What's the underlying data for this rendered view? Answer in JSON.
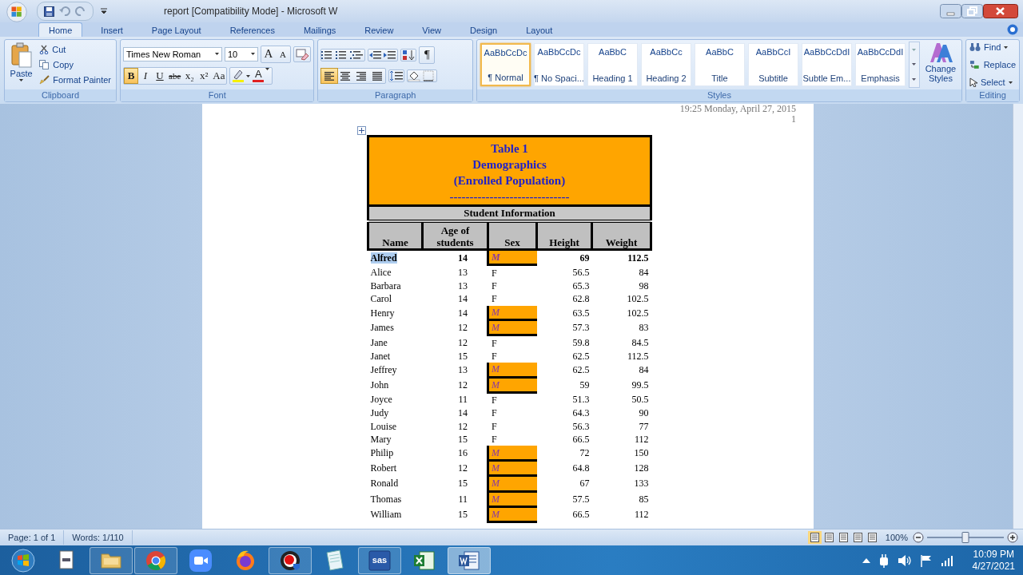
{
  "title_bar": {
    "title": "report [Compatibility Mode] - Microsoft W"
  },
  "tabs": [
    {
      "label": "Home",
      "selected": true
    },
    {
      "label": "Insert",
      "selected": false
    },
    {
      "label": "Page Layout",
      "selected": false
    },
    {
      "label": "References",
      "selected": false
    },
    {
      "label": "Mailings",
      "selected": false
    },
    {
      "label": "Review",
      "selected": false
    },
    {
      "label": "View",
      "selected": false
    },
    {
      "label": "Design",
      "selected": false
    },
    {
      "label": "Layout",
      "selected": false
    }
  ],
  "ribbon": {
    "clipboard": {
      "label": "Clipboard",
      "paste": "Paste",
      "items": [
        "Cut",
        "Copy",
        "Format Painter"
      ]
    },
    "font": {
      "label": "Font",
      "font_name": "Times New Roman",
      "font_size": "10",
      "size_buttons": [
        "A",
        "A"
      ],
      "format_buttons": [
        {
          "text": "B",
          "on": true
        },
        {
          "text": "I",
          "on": false
        },
        {
          "text": "U",
          "on": false
        },
        {
          "text": "abe",
          "on": false
        },
        {
          "text": "x₂",
          "on": false
        },
        {
          "text": "x²",
          "on": false
        },
        {
          "text": "Aa",
          "on": false
        }
      ],
      "font_color": "A"
    },
    "paragraph": {
      "label": "Paragraph",
      "pilcrow": "¶",
      "alignments": [
        {
          "selected": true
        },
        {
          "selected": false
        },
        {
          "selected": false
        },
        {
          "selected": false
        }
      ]
    },
    "styles": {
      "label": "Styles",
      "change_styles": "Change Styles",
      "gallery": [
        {
          "sample": "AaBbCcDc",
          "label": "¶ Normal",
          "selected": true
        },
        {
          "sample": "AaBbCcDc",
          "label": "¶ No Spaci...",
          "selected": false
        },
        {
          "sample": "AaBbC",
          "label": "Heading 1",
          "selected": false
        },
        {
          "sample": "AaBbCc",
          "label": "Heading 2",
          "selected": false
        },
        {
          "sample": "AaBbC",
          "label": "Title",
          "selected": false
        },
        {
          "sample": "AaBbCcI",
          "label": "Subtitle",
          "selected": false
        },
        {
          "sample": "AaBbCcDdI",
          "label": "Subtle Em...",
          "selected": false
        },
        {
          "sample": "AaBbCcDdI",
          "label": "Emphasis",
          "selected": false
        }
      ]
    },
    "editing": {
      "label": "Editing",
      "items": [
        "Find",
        "Replace",
        "Select"
      ]
    }
  },
  "document": {
    "header_date": "19:25 Monday, April 27, 2015",
    "page_number": "1",
    "table": {
      "title_lines": [
        "Table 1",
        "Demographics",
        "(Enrolled Population)",
        "------------------------------"
      ],
      "section": "Student Information",
      "columns": [
        "Name",
        "Age of students",
        "Sex",
        "Height",
        "Weight"
      ],
      "rows": [
        {
          "cells": [
            "Alfred",
            "14",
            "M",
            "69",
            "112.5"
          ],
          "bold": true,
          "selected": true,
          "highlighted": true
        },
        {
          "cells": [
            "Alice",
            "13",
            "F",
            "56.5",
            "84"
          ],
          "bold": false,
          "selected": false,
          "highlighted": false
        },
        {
          "cells": [
            "Barbara",
            "13",
            "F",
            "65.3",
            "98"
          ],
          "bold": false,
          "selected": false,
          "highlighted": false
        },
        {
          "cells": [
            "Carol",
            "14",
            "F",
            "62.8",
            "102.5"
          ],
          "bold": false,
          "selected": false,
          "highlighted": false
        },
        {
          "cells": [
            "Henry",
            "14",
            "M",
            "63.5",
            "102.5"
          ],
          "bold": false,
          "selected": false,
          "highlighted": true
        },
        {
          "cells": [
            "James",
            "12",
            "M",
            "57.3",
            "83"
          ],
          "bold": false,
          "selected": false,
          "highlighted": true
        },
        {
          "cells": [
            "Jane",
            "12",
            "F",
            "59.8",
            "84.5"
          ],
          "bold": false,
          "selected": false,
          "highlighted": false
        },
        {
          "cells": [
            "Janet",
            "15",
            "F",
            "62.5",
            "112.5"
          ],
          "bold": false,
          "selected": false,
          "highlighted": false
        },
        {
          "cells": [
            "Jeffrey",
            "13",
            "M",
            "62.5",
            "84"
          ],
          "bold": false,
          "selected": false,
          "highlighted": true
        },
        {
          "cells": [
            "John",
            "12",
            "M",
            "59",
            "99.5"
          ],
          "bold": false,
          "selected": false,
          "highlighted": true
        },
        {
          "cells": [
            "Joyce",
            "11",
            "F",
            "51.3",
            "50.5"
          ],
          "bold": false,
          "selected": false,
          "highlighted": false
        },
        {
          "cells": [
            "Judy",
            "14",
            "F",
            "64.3",
            "90"
          ],
          "bold": false,
          "selected": false,
          "highlighted": false
        },
        {
          "cells": [
            "Louise",
            "12",
            "F",
            "56.3",
            "77"
          ],
          "bold": false,
          "selected": false,
          "highlighted": false
        },
        {
          "cells": [
            "Mary",
            "15",
            "F",
            "66.5",
            "112"
          ],
          "bold": false,
          "selected": false,
          "highlighted": false
        },
        {
          "cells": [
            "Philip",
            "16",
            "M",
            "72",
            "150"
          ],
          "bold": false,
          "selected": false,
          "highlighted": true
        },
        {
          "cells": [
            "Robert",
            "12",
            "M",
            "64.8",
            "128"
          ],
          "bold": false,
          "selected": false,
          "highlighted": true
        },
        {
          "cells": [
            "Ronald",
            "15",
            "M",
            "67",
            "133"
          ],
          "bold": false,
          "selected": false,
          "highlighted": true
        },
        {
          "cells": [
            "Thomas",
            "11",
            "M",
            "57.5",
            "85"
          ],
          "bold": false,
          "selected": false,
          "highlighted": true
        },
        {
          "cells": [
            "William",
            "15",
            "M",
            "66.5",
            "112"
          ],
          "bold": false,
          "selected": false,
          "highlighted": true
        }
      ]
    }
  },
  "status_bar": {
    "page": "Page: 1 of 1",
    "words": "Words: 1/110",
    "zoom": "100%",
    "views": [
      {
        "selected": true
      },
      {
        "selected": false
      },
      {
        "selected": false
      },
      {
        "selected": false
      },
      {
        "selected": false
      }
    ],
    "zoom_slider": {
      "level": 0.5
    }
  },
  "taskbar": {
    "apps": [
      {
        "kind": "page",
        "running": false,
        "active": false
      },
      {
        "kind": "folder",
        "running": true,
        "active": false
      },
      {
        "kind": "wheel",
        "running": true,
        "active": false
      },
      {
        "kind": "camera",
        "running": false,
        "active": false
      },
      {
        "kind": "flame",
        "running": false,
        "active": false
      },
      {
        "kind": "record",
        "running": true,
        "active": false
      },
      {
        "kind": "notepad",
        "running": false,
        "active": false
      },
      {
        "kind": "sas",
        "label": "sas",
        "running": true,
        "active": false
      },
      {
        "kind": "sheet",
        "running": false,
        "active": false
      },
      {
        "kind": "word",
        "running": true,
        "active": true
      }
    ],
    "clock": {
      "time": "10:09 PM",
      "date": "4/27/2021"
    }
  }
}
